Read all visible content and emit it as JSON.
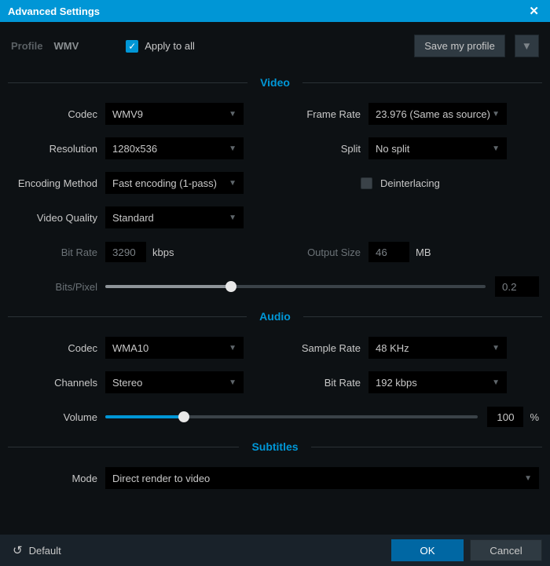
{
  "titlebar": {
    "title": "Advanced Settings"
  },
  "header": {
    "profile_label": "Profile",
    "profile_name": "WMV",
    "apply_all": "Apply to all",
    "save_profile": "Save my profile"
  },
  "sections": {
    "video": "Video",
    "audio": "Audio",
    "subtitles": "Subtitles"
  },
  "video": {
    "labels": {
      "codec": "Codec",
      "frame_rate": "Frame Rate",
      "resolution": "Resolution",
      "split": "Split",
      "encoding": "Encoding Method",
      "deinterlace": "Deinterlacing",
      "quality": "Video Quality",
      "bit_rate": "Bit Rate",
      "bit_rate_unit": "kbps",
      "output_size": "Output Size",
      "output_unit": "MB",
      "bits_pixel": "Bits/Pixel"
    },
    "values": {
      "codec": "WMV9",
      "frame_rate": "23.976 (Same as source)",
      "resolution": "1280x536",
      "split": "No split",
      "encoding": "Fast encoding (1-pass)",
      "quality": "Standard",
      "bit_rate": "3290",
      "output_size": "46",
      "bits_pixel": "0.2"
    },
    "bits_slider_percent": 33
  },
  "audio": {
    "labels": {
      "codec": "Codec",
      "sample_rate": "Sample Rate",
      "channels": "Channels",
      "bit_rate": "Bit Rate",
      "volume": "Volume",
      "volume_unit": "%"
    },
    "values": {
      "codec": "WMA10",
      "sample_rate": "48 KHz",
      "channels": "Stereo",
      "bit_rate": "192 kbps",
      "volume": "100"
    },
    "volume_percent": 21
  },
  "subtitles": {
    "labels": {
      "mode": "Mode"
    },
    "values": {
      "mode": "Direct render to video"
    }
  },
  "footer": {
    "default": "Default",
    "ok": "OK",
    "cancel": "Cancel"
  }
}
